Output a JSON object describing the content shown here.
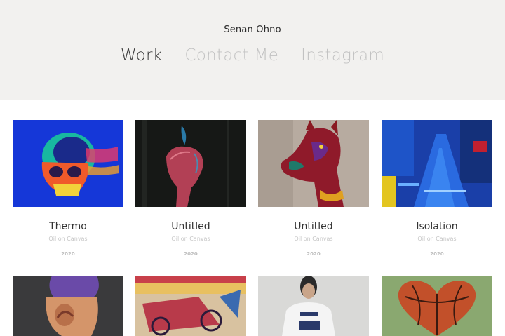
{
  "site": {
    "title": "Senan Ohno"
  },
  "nav": {
    "items": [
      "Work",
      "Contact Me",
      "Instagram"
    ],
    "active": "Work"
  },
  "works": [
    {
      "title": "Thermo",
      "medium": "Oil on Canvas",
      "year": "2020"
    },
    {
      "title": "Untitled",
      "medium": "Oil on Canvas",
      "year": "2020"
    },
    {
      "title": "Untitled",
      "medium": "Oil on Canvas",
      "year": "2020"
    },
    {
      "title": "Isolation",
      "medium": "Oil on Canvas",
      "year": "2020"
    }
  ],
  "colors": {
    "header_bg": "#f2f1ef",
    "nav_active": "#3a3a3a",
    "nav_inactive": "#c2c2c2"
  }
}
